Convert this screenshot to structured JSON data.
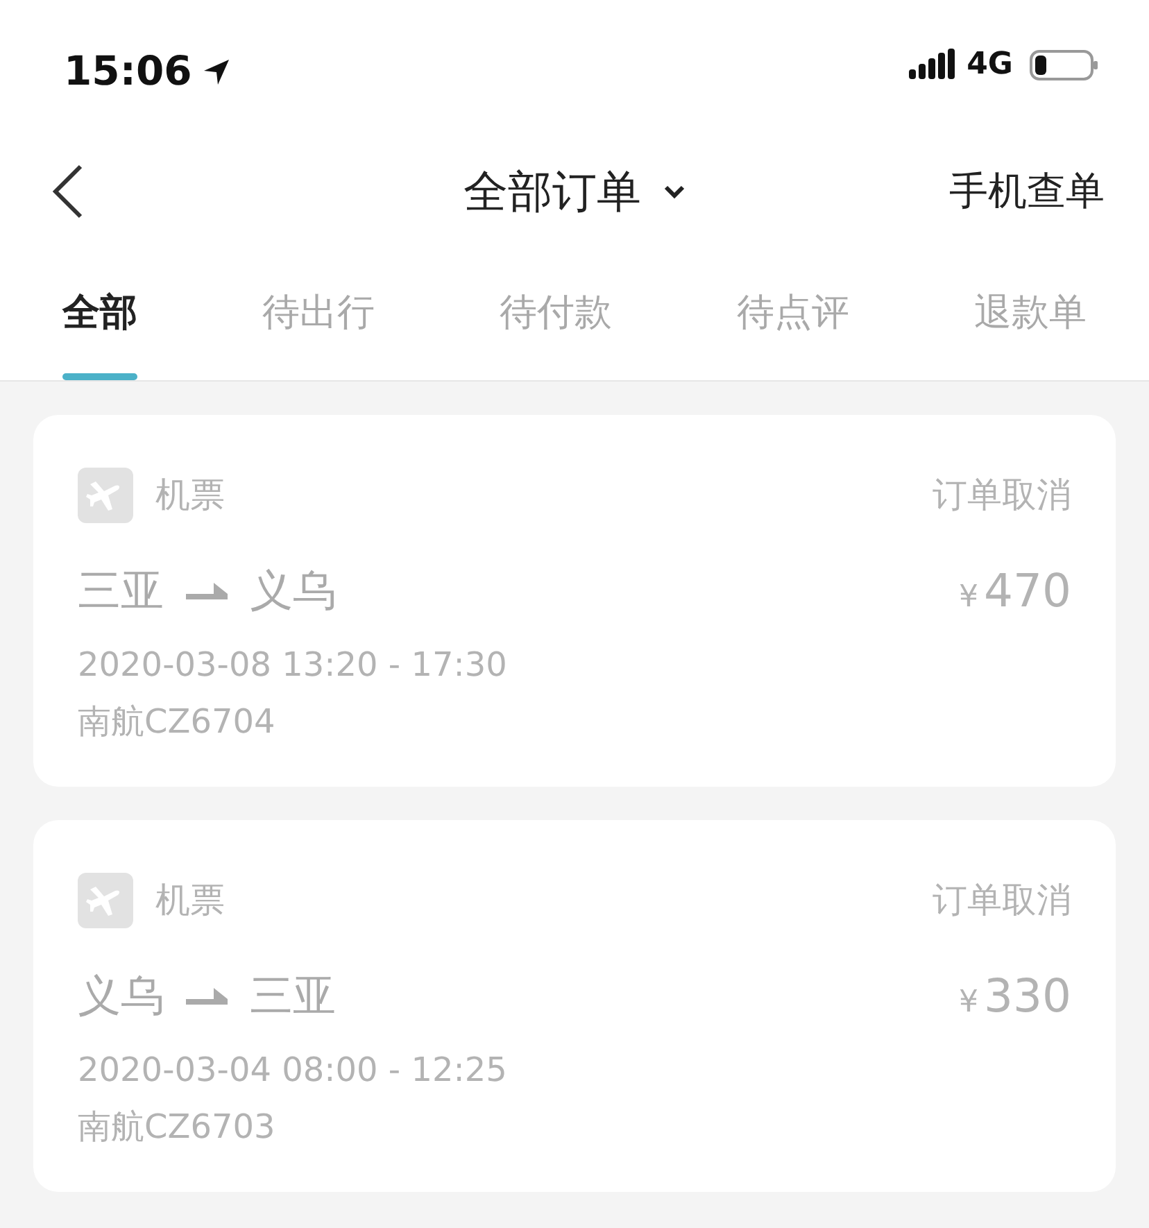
{
  "status_bar": {
    "time": "15:06",
    "network": "4G"
  },
  "nav": {
    "title": "全部订单",
    "right_action": "手机查单"
  },
  "tabs": [
    {
      "label": "全部",
      "selected": true
    },
    {
      "label": "待出行",
      "selected": false
    },
    {
      "label": "待付款",
      "selected": false
    },
    {
      "label": "待点评",
      "selected": false
    },
    {
      "label": "退款单",
      "selected": false
    }
  ],
  "orders": [
    {
      "category": "机票",
      "status": "订单取消",
      "from": "三亚",
      "to": "义乌",
      "currency": "¥",
      "amount": "470",
      "time": "2020-03-08 13:20 - 17:30",
      "flight": "南航CZ6704"
    },
    {
      "category": "机票",
      "status": "订单取消",
      "from": "义乌",
      "to": "三亚",
      "currency": "¥",
      "amount": "330",
      "time": "2020-03-04 08:00 - 12:25",
      "flight": "南航CZ6703"
    }
  ]
}
